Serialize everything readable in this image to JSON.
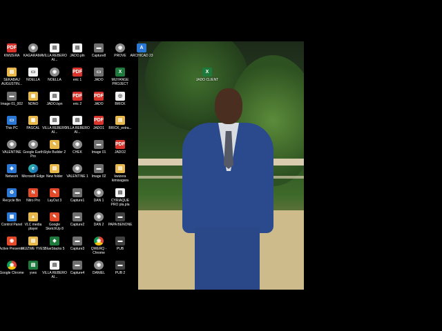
{
  "icons": [
    {
      "label": "KWIZERA",
      "glyph": "PDF",
      "cls": "g-pdf",
      "col": 0,
      "row": 0
    },
    {
      "label": "KAGARAMA",
      "glyph": "◉",
      "cls": "g-app",
      "col": 1,
      "row": 0
    },
    {
      "label": "VILLA REBERO AI...",
      "glyph": "▤",
      "cls": "g-doc",
      "col": 2,
      "row": 0
    },
    {
      "label": "JADO.pln",
      "glyph": "▤",
      "cls": "g-doc",
      "col": 3,
      "row": 0
    },
    {
      "label": "Capture8",
      "glyph": "▬",
      "cls": "g-img",
      "col": 4,
      "row": 0
    },
    {
      "label": "PROVE",
      "glyph": "◉",
      "cls": "g-app",
      "col": 5,
      "row": 0
    },
    {
      "label": "ARCHICAD 23",
      "glyph": "A",
      "cls": "g-blue",
      "col": 6,
      "row": 0
    },
    {
      "label": "SEKABAU AUGUSTIN...",
      "glyph": "▤",
      "cls": "g-folder",
      "col": 0,
      "row": 1
    },
    {
      "label": "NOELLA",
      "glyph": "▭",
      "cls": "g-doc",
      "col": 1,
      "row": 1
    },
    {
      "label": "NOELLA",
      "glyph": "◉",
      "cls": "g-app",
      "col": 2,
      "row": 1
    },
    {
      "label": "eric 1",
      "glyph": "PDF",
      "cls": "g-pdf",
      "col": 3,
      "row": 1
    },
    {
      "label": "JADO",
      "glyph": "▭",
      "cls": "g-img",
      "col": 4,
      "row": 1
    },
    {
      "label": "MUYANGE PROJECT",
      "glyph": "X",
      "cls": "g-green",
      "col": 5,
      "row": 1
    },
    {
      "label": "Image 01_002",
      "glyph": "▬",
      "cls": "g-img",
      "col": 0,
      "row": 2
    },
    {
      "label": "NDNO",
      "glyph": "▦",
      "cls": "g-folder",
      "col": 1,
      "row": 2
    },
    {
      "label": "JADO.bpn",
      "glyph": "▤",
      "cls": "g-doc",
      "col": 2,
      "row": 2
    },
    {
      "label": "eric 2",
      "glyph": "PDF",
      "cls": "g-pdf",
      "col": 3,
      "row": 2
    },
    {
      "label": "JADO",
      "glyph": "PDF",
      "cls": "g-pdf",
      "col": 4,
      "row": 2
    },
    {
      "label": "BRICK",
      "glyph": "◎",
      "cls": "g-doc",
      "col": 5,
      "row": 2
    },
    {
      "label": "This PC",
      "glyph": "▭",
      "cls": "g-blue",
      "col": 0,
      "row": 3
    },
    {
      "label": "PASCAL",
      "glyph": "▦",
      "cls": "g-folder",
      "col": 1,
      "row": 3
    },
    {
      "label": "VILLA REBERO AI...",
      "glyph": "▤",
      "cls": "g-doc",
      "col": 2,
      "row": 3
    },
    {
      "label": "VILLA REBERO AI...",
      "glyph": "▤",
      "cls": "g-doc",
      "col": 3,
      "row": 3
    },
    {
      "label": "JADO1",
      "glyph": "PDF",
      "cls": "g-pdf",
      "col": 4,
      "row": 3
    },
    {
      "label": "BRICK_extra...",
      "glyph": "▤",
      "cls": "g-folder",
      "col": 5,
      "row": 3
    },
    {
      "label": "VALENTINE",
      "glyph": "◉",
      "cls": "g-app",
      "col": 0,
      "row": 4
    },
    {
      "label": "Google Earth Pro",
      "glyph": "◉",
      "cls": "g-app",
      "col": 1,
      "row": 4
    },
    {
      "label": "Style Builder 2",
      "glyph": "✎",
      "cls": "g-folder",
      "col": 2,
      "row": 4
    },
    {
      "label": "CHEK",
      "glyph": "◉",
      "cls": "g-app",
      "col": 3,
      "row": 4
    },
    {
      "label": "Image 01",
      "glyph": "▬",
      "cls": "g-img",
      "col": 4,
      "row": 4
    },
    {
      "label": "JADO2",
      "glyph": "PDF",
      "cls": "g-pdf",
      "col": 5,
      "row": 4
    },
    {
      "label": "Network",
      "glyph": "◈",
      "cls": "g-blue",
      "col": 0,
      "row": 5
    },
    {
      "label": "Microsoft Edge",
      "glyph": "e",
      "cls": "g-edge",
      "col": 1,
      "row": 5
    },
    {
      "label": "New folder",
      "glyph": "▤",
      "cls": "g-folder",
      "col": 2,
      "row": 5
    },
    {
      "label": "VALENTINE 1",
      "glyph": "◉",
      "cls": "g-app",
      "col": 3,
      "row": 5
    },
    {
      "label": "Image 02",
      "glyph": "▬",
      "cls": "g-img",
      "col": 4,
      "row": 5
    },
    {
      "label": "kwizera kimisagara",
      "glyph": "▤",
      "cls": "g-folder",
      "col": 5,
      "row": 5
    },
    {
      "label": "Recycle Bin",
      "glyph": "♻",
      "cls": "g-blue",
      "col": 0,
      "row": 6
    },
    {
      "label": "Nitro Pro",
      "glyph": "N",
      "cls": "g-red",
      "col": 1,
      "row": 6
    },
    {
      "label": "LayOut 3",
      "glyph": "✎",
      "cls": "g-red",
      "col": 2,
      "row": 6
    },
    {
      "label": "Capture1",
      "glyph": "▬",
      "cls": "g-img",
      "col": 3,
      "row": 6
    },
    {
      "label": "DAN 1",
      "glyph": "◉",
      "cls": "g-app",
      "col": 4,
      "row": 6
    },
    {
      "label": "CYRIAQUE PRO pla.pla",
      "glyph": "▤",
      "cls": "g-doc",
      "col": 5,
      "row": 6
    },
    {
      "label": "Control Panel",
      "glyph": "▦",
      "cls": "g-blue",
      "col": 0,
      "row": 7
    },
    {
      "label": "VLC media player",
      "glyph": "▲",
      "cls": "g-folder",
      "col": 1,
      "row": 7
    },
    {
      "label": "Google SketchUp 8",
      "glyph": "✎",
      "cls": "g-red",
      "col": 2,
      "row": 7
    },
    {
      "label": "Capture2",
      "glyph": "▬",
      "cls": "g-img",
      "col": 3,
      "row": 7
    },
    {
      "label": "DAN 2",
      "glyph": "◉",
      "cls": "g-app",
      "col": 4,
      "row": 7
    },
    {
      "label": "PAPA BENONE",
      "glyph": "▬",
      "cls": "g-dark",
      "col": 5,
      "row": 7
    },
    {
      "label": "Active Presenter",
      "glyph": "◉",
      "cls": "g-red",
      "col": 0,
      "row": 8
    },
    {
      "label": "IKUZWE YVES",
      "glyph": "▤",
      "cls": "g-folder",
      "col": 1,
      "row": 8
    },
    {
      "label": "BlueStacks 5",
      "glyph": "◆",
      "cls": "g-green",
      "col": 2,
      "row": 8
    },
    {
      "label": "Capture3",
      "glyph": "▬",
      "cls": "g-img",
      "col": 3,
      "row": 8
    },
    {
      "label": "QWERQ - Chrome",
      "glyph": "◉",
      "cls": "g-chrome",
      "col": 4,
      "row": 8
    },
    {
      "label": "PUB",
      "glyph": "▬",
      "cls": "g-dark",
      "col": 5,
      "row": 8
    },
    {
      "label": "Google Chrome",
      "glyph": "◉",
      "cls": "g-chrome",
      "col": 0,
      "row": 9
    },
    {
      "label": "yves",
      "glyph": "▤",
      "cls": "g-green",
      "col": 1,
      "row": 9
    },
    {
      "label": "VILLA REBERO AI...",
      "glyph": "▤",
      "cls": "g-doc",
      "col": 2,
      "row": 9
    },
    {
      "label": "Capture4",
      "glyph": "▬",
      "cls": "g-img",
      "col": 3,
      "row": 9
    },
    {
      "label": "DANIEL",
      "glyph": "◉",
      "cls": "g-app",
      "col": 4,
      "row": 9
    },
    {
      "label": "PUB 2",
      "glyph": "▬",
      "cls": "g-dark",
      "col": 5,
      "row": 9
    },
    {
      "label": "JADO CLIENT",
      "glyph": "X",
      "cls": "g-green",
      "col": 8,
      "row": 1
    }
  ]
}
